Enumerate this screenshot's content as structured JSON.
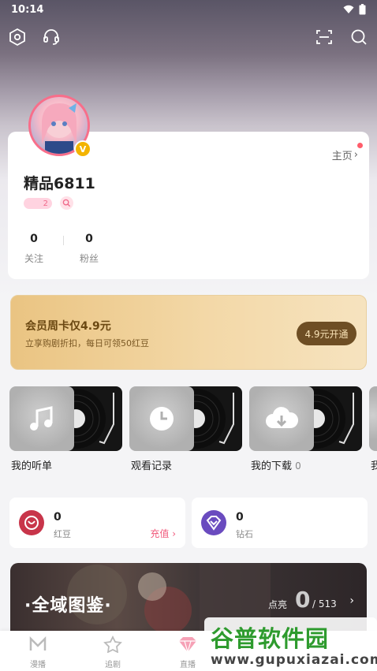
{
  "status_bar": {
    "time": "10:14"
  },
  "profile": {
    "home_label": "主页",
    "username": "精品6811",
    "level": "2",
    "stats": [
      {
        "value": "0",
        "label": "关注"
      },
      {
        "value": "0",
        "label": "粉丝"
      }
    ]
  },
  "vip": {
    "title": "会员周卡仅4.9元",
    "subtitle": "立享购剧折扣，每日可领50红豆",
    "button": "4.9元开通"
  },
  "media": [
    {
      "label": "我的听单",
      "count": ""
    },
    {
      "label": "观看记录",
      "count": ""
    },
    {
      "label": "我的下载",
      "count": "0"
    },
    {
      "label": "我",
      "count": ""
    }
  ],
  "wallet": {
    "red_bean": {
      "value": "0",
      "label": "红豆",
      "action": "充值"
    },
    "diamond": {
      "value": "0",
      "label": "钻石"
    }
  },
  "gallery": {
    "title": "·全域图鉴·",
    "lit_label": "点亮",
    "lit_count": "0",
    "total": "/ 513"
  },
  "bottom_nav": [
    {
      "label": "漫播",
      "icon": "manbo-logo-icon"
    },
    {
      "label": "追剧",
      "icon": "star-icon"
    },
    {
      "label": "直播",
      "icon": "live-gem-icon"
    }
  ],
  "watermark": {
    "title": "谷普软件园",
    "url": "www.gupuxiazai.com"
  },
  "colors": {
    "accent_pink": "#f0597b",
    "vip_gold": "#eac482",
    "vip_button": "#6e4e24"
  }
}
